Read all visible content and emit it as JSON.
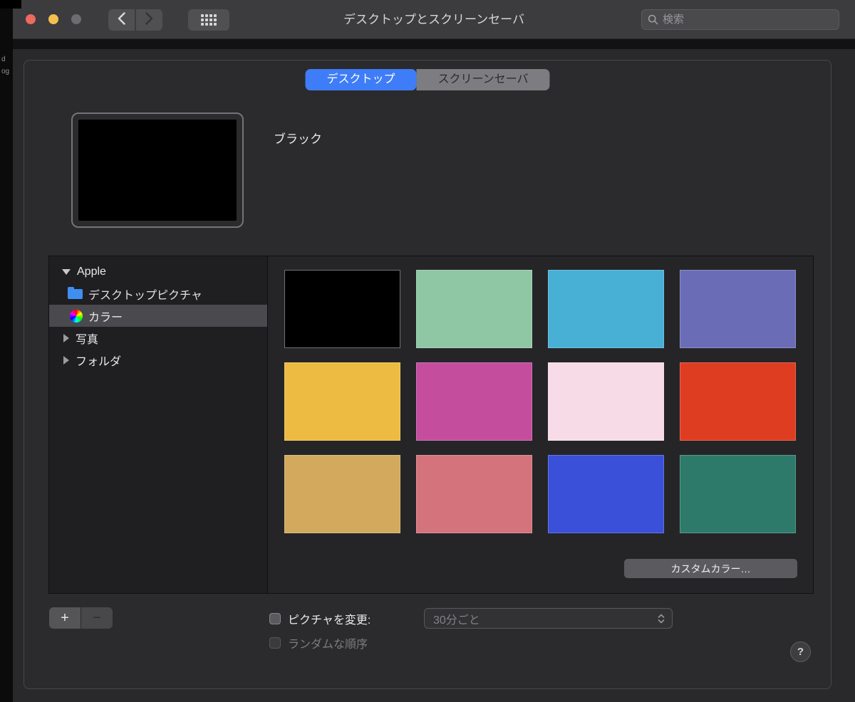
{
  "background": {
    "fragments": [
      "d",
      "og"
    ]
  },
  "toolbar": {
    "title": "デスクトップとスクリーンセーバ",
    "search_placeholder": "検索"
  },
  "tabs": {
    "desktop": "デスクトップ",
    "screensaver": "スクリーンセーバ"
  },
  "preview": {
    "name": "ブラック"
  },
  "sidebar": {
    "group": "Apple",
    "desktop_pictures": "デスクトップピクチャ",
    "colors": "カラー",
    "photos": "写真",
    "folders": "フォルダ"
  },
  "swatches": {
    "colors": [
      "#000000",
      "#8fc7a4",
      "#49b0d5",
      "#6a6db6",
      "#eebb42",
      "#c44d9e",
      "#f7dbe6",
      "#de3d22",
      "#d2a95d",
      "#d4737c",
      "#3b50d8",
      "#2d7a6a"
    ],
    "custom_color_button": "カスタムカラー…"
  },
  "footer": {
    "add": "+",
    "remove": "−",
    "change_picture": "ピクチャを変更:",
    "interval": "30分ごと",
    "random_order": "ランダムな順序",
    "help": "?"
  },
  "colors": {
    "accent": "#3e7df7"
  }
}
